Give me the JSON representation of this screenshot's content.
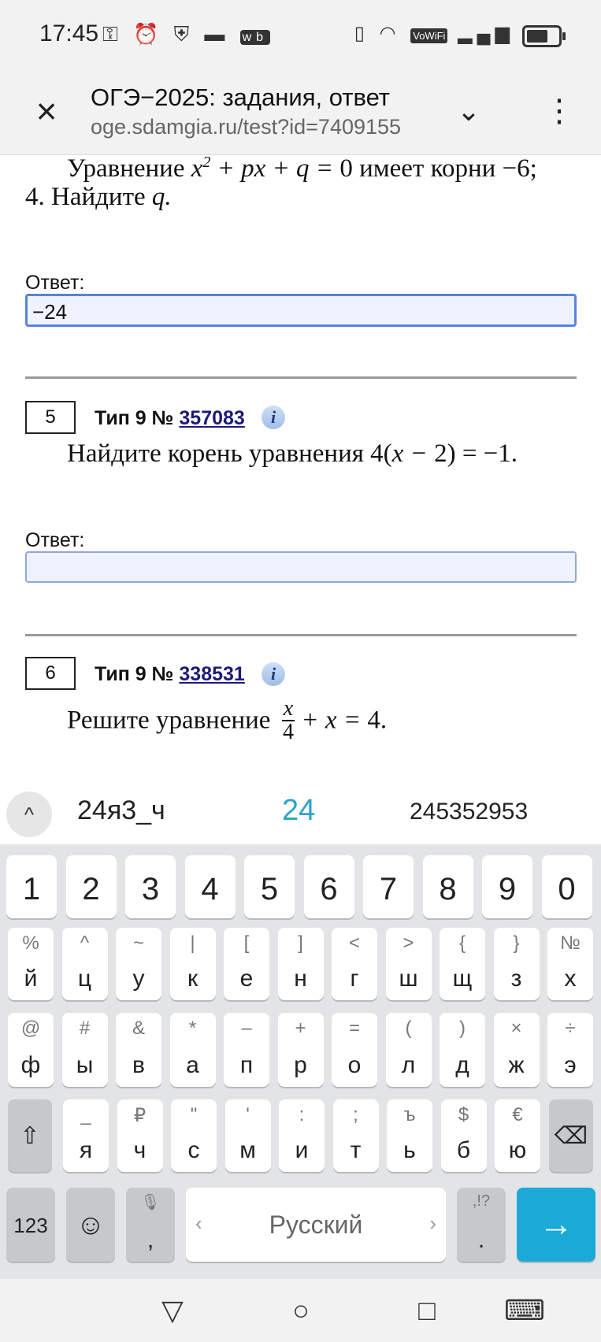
{
  "status_bar": {
    "time": "17:45",
    "left_icons": [
      "key-icon",
      "alarm-icon",
      "shield-icon",
      "folder-icon",
      "wb-icon"
    ],
    "right_icons": [
      "vibrate-icon",
      "wifi-icon",
      "vowifi-icon",
      "signal-icon",
      "battery-icon"
    ],
    "vowifi_label": "VoWiFi",
    "wb_label": "wb"
  },
  "toolbar": {
    "close_icon": "×",
    "title": "ОГЭ−2025: задания, ответ",
    "url": "oge.sdamgia.ru/test?id=7409155",
    "chevron_icon": "⌄",
    "menu_icon": "⋮"
  },
  "task4": {
    "line1_text": "Уравнение",
    "line1_after": "имеет корни −6;",
    "line2_text": "4. Найдите",
    "answer_label": "Ответ:",
    "answer_value": "−24"
  },
  "task5": {
    "number": "5",
    "type_prefix": "Тип 9 №",
    "id": "357083",
    "info": "i",
    "question": "Найдите корень уравнения",
    "answer_label": "Ответ:",
    "answer_value": ""
  },
  "task6": {
    "number": "6",
    "type_prefix": "Тип 9 №",
    "id": "338531",
    "info": "i",
    "question": "Решите уравнение"
  },
  "suggestions": {
    "expand": "^",
    "items": [
      "24я3_ч",
      "24",
      "245352953"
    ],
    "highlight_color": "#2aa3c9"
  },
  "keyboard": {
    "digits": [
      "1",
      "2",
      "3",
      "4",
      "5",
      "6",
      "7",
      "8",
      "9",
      "0"
    ],
    "row1": [
      {
        "sym": "%",
        "main": "й"
      },
      {
        "sym": "^",
        "main": "ц"
      },
      {
        "sym": "~",
        "main": "у"
      },
      {
        "sym": "|",
        "main": "к"
      },
      {
        "sym": "[",
        "main": "е"
      },
      {
        "sym": "]",
        "main": "н"
      },
      {
        "sym": "<",
        "main": "г"
      },
      {
        "sym": ">",
        "main": "ш"
      },
      {
        "sym": "{",
        "main": "щ"
      },
      {
        "sym": "}",
        "main": "з"
      },
      {
        "sym": "№",
        "main": "х"
      }
    ],
    "row2": [
      {
        "sym": "@",
        "main": "ф"
      },
      {
        "sym": "#",
        "main": "ы"
      },
      {
        "sym": "&",
        "main": "в"
      },
      {
        "sym": "*",
        "main": "а"
      },
      {
        "sym": "–",
        "main": "п"
      },
      {
        "sym": "+",
        "main": "р"
      },
      {
        "sym": "=",
        "main": "о"
      },
      {
        "sym": "(",
        "main": "л"
      },
      {
        "sym": ")",
        "main": "д"
      },
      {
        "sym": "×",
        "main": "ж"
      },
      {
        "sym": "÷",
        "main": "э"
      }
    ],
    "row3": [
      {
        "sym": "_",
        "main": "я"
      },
      {
        "sym": "₽",
        "main": "ч"
      },
      {
        "sym": "\"",
        "main": "с"
      },
      {
        "sym": "'",
        "main": "м"
      },
      {
        "sym": ":",
        "main": "и"
      },
      {
        "sym": ";",
        "main": "т"
      },
      {
        "sym": "ъ",
        "main": "ь"
      },
      {
        "sym": "$",
        "main": "б"
      },
      {
        "sym": "€",
        "main": "ю"
      }
    ],
    "shift_icon": "⇧",
    "backspace_icon": "⌫",
    "mode_key": "123",
    "emoji_icon": "☺",
    "mic_icon": "🎙",
    "comma": ",",
    "space_label": "Русский",
    "space_left": "‹",
    "space_right": "›",
    "punct_top": ",!?",
    "punct_main": ".",
    "enter_icon": "→"
  },
  "nav_bar": {
    "back_icon": "▽",
    "home_icon": "○",
    "recents_icon": "□",
    "keyboard_icon": "⌨"
  }
}
